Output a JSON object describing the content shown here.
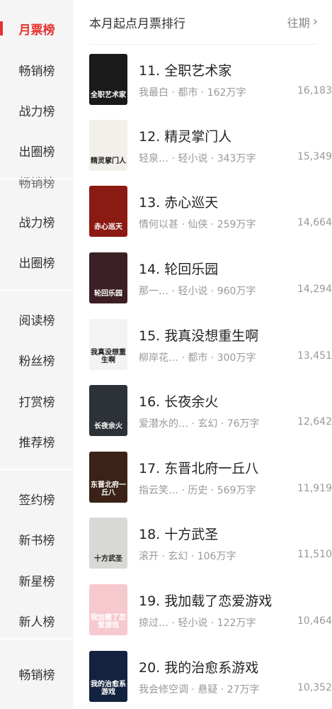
{
  "sidebar": {
    "items": [
      {
        "label": "月票榜",
        "active": true
      },
      {
        "label": "畅销榜"
      },
      {
        "label": "战力榜"
      },
      {
        "label": "出圈榜"
      },
      {
        "label": "畅销榜"
      },
      {
        "label": "战力榜"
      },
      {
        "label": "出圈榜"
      },
      {
        "label": "阅读榜"
      },
      {
        "label": "粉丝榜"
      },
      {
        "label": "打赏榜"
      },
      {
        "label": "推荐榜"
      },
      {
        "label": "签约榜"
      },
      {
        "label": "新书榜"
      },
      {
        "label": "新星榜"
      },
      {
        "label": "新人榜"
      },
      {
        "label": "畅销榜"
      }
    ]
  },
  "header": {
    "title": "本月起点月票排行",
    "more": "往期"
  },
  "books": [
    {
      "title": "11. 全职艺术家",
      "author": "我最白",
      "genre": "都市",
      "words": "162万字",
      "count": "16,183",
      "cover_text": "全职艺术家",
      "cover_bg": "#1a1a1a"
    },
    {
      "title": "12. 精灵掌门人",
      "author": "轻泉…",
      "genre": "轻小说",
      "words": "343万字",
      "count": "15,349",
      "cover_text": "精灵掌门人",
      "cover_bg": "#f2f0ea"
    },
    {
      "title": "13. 赤心巡天",
      "author": "情何以甚",
      "genre": "仙侠",
      "words": "259万字",
      "count": "14,664",
      "cover_text": "赤心巡天",
      "cover_bg": "#8b1a12"
    },
    {
      "title": "14. 轮回乐园",
      "author": "那一…",
      "genre": "轻小说",
      "words": "960万字",
      "count": "14,294",
      "cover_text": "轮回乐园",
      "cover_bg": "#3b1f24"
    },
    {
      "title": "15. 我真没想重生啊",
      "author": "柳岸花…",
      "genre": "都市",
      "words": "300万字",
      "count": "13,451",
      "cover_text": "我真没想重生啊",
      "cover_bg": "#f3f3f3"
    },
    {
      "title": "16. 长夜余火",
      "author": "爱潜水的…",
      "genre": "玄幻",
      "words": "76万字",
      "count": "12,642",
      "cover_text": "长夜余火",
      "cover_bg": "#2d3238"
    },
    {
      "title": "17. 东晋北府一丘八",
      "author": "指云笑…",
      "genre": "历史",
      "words": "569万字",
      "count": "11,919",
      "cover_text": "东晋北府一丘八",
      "cover_bg": "#3a2316"
    },
    {
      "title": "18. 十方武圣",
      "author": "滚开",
      "genre": "玄幻",
      "words": "106万字",
      "count": "11,510",
      "cover_text": "十方武圣",
      "cover_bg": "#d8d8d4"
    },
    {
      "title": "19. 我加载了恋爱游戏",
      "author": "掠过…",
      "genre": "轻小说",
      "words": "122万字",
      "count": "10,464",
      "cover_text": "我加载了恋爱游戏",
      "cover_bg": "#f6c9cf"
    },
    {
      "title": "20. 我的治愈系游戏",
      "author": "我会修空调",
      "genre": "悬疑",
      "words": "27万字",
      "count": "10,352",
      "cover_text": "我的治愈系游戏",
      "cover_bg": "#13223f"
    }
  ],
  "colors": {
    "accent": "#e5332f"
  }
}
